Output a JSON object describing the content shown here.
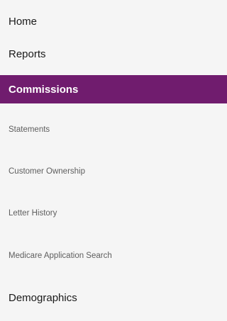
{
  "nav": {
    "items": [
      {
        "label": "Home"
      },
      {
        "label": "Reports"
      },
      {
        "label": "Commissions"
      },
      {
        "label": "Statements"
      },
      {
        "label": "Customer Ownership"
      },
      {
        "label": "Letter History"
      },
      {
        "label": "Medicare Application Search"
      },
      {
        "label": "Demographics"
      }
    ]
  },
  "colors": {
    "active_background": "#701c6e",
    "active_text": "#ffffff",
    "background": "#f5f5f5",
    "primary_text": "#1a1a1a",
    "secondary_text": "#5e5e5e"
  }
}
